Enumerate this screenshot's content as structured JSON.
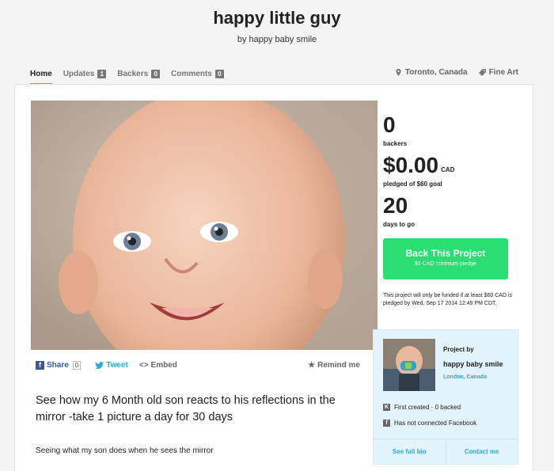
{
  "project": {
    "title": "happy little guy",
    "byline": "by happy baby smile"
  },
  "nav": {
    "tabs": [
      {
        "label": "Home",
        "count": null
      },
      {
        "label": "Updates",
        "count": "1"
      },
      {
        "label": "Backers",
        "count": "0"
      },
      {
        "label": "Comments",
        "count": "0"
      }
    ],
    "location": "Toronto, Canada",
    "category": "Fine Art"
  },
  "stats": {
    "backers_value": "0",
    "backers_label": "backers",
    "pledged_value": "$0.00",
    "pledged_currency": "CAD",
    "pledged_label": "pledged of $60 goal",
    "days_value": "20",
    "days_label": "days to go"
  },
  "back_button": {
    "label": "Back This Project",
    "sub": "$1 CAD minimum pledge"
  },
  "funding_note": "This project will only be funded if at least $60 CAD is pledged by Wed, Sep 17 2014 12:49 PM CDT.",
  "share": {
    "facebook": "Share",
    "facebook_count": "0",
    "tweet": "Tweet",
    "embed": "Embed",
    "remind": "Remind me"
  },
  "blurb": "See how my 6 Month old son reacts to his reflections in the mirror -take 1 picture a day for 30 days",
  "description": "Seeing what my son does when he sees the mirror",
  "creator": {
    "label": "Project by",
    "name": "happy baby smile",
    "location": "London, Canada",
    "first_created": "First created · 0 backed",
    "facebook": "Has not connected Facebook",
    "see_bio": "See full bio",
    "contact": "Contact me"
  },
  "colors": {
    "accent_green": "#2bde73",
    "link_blue": "#2aa9e0",
    "facebook_blue": "#3b5998"
  }
}
